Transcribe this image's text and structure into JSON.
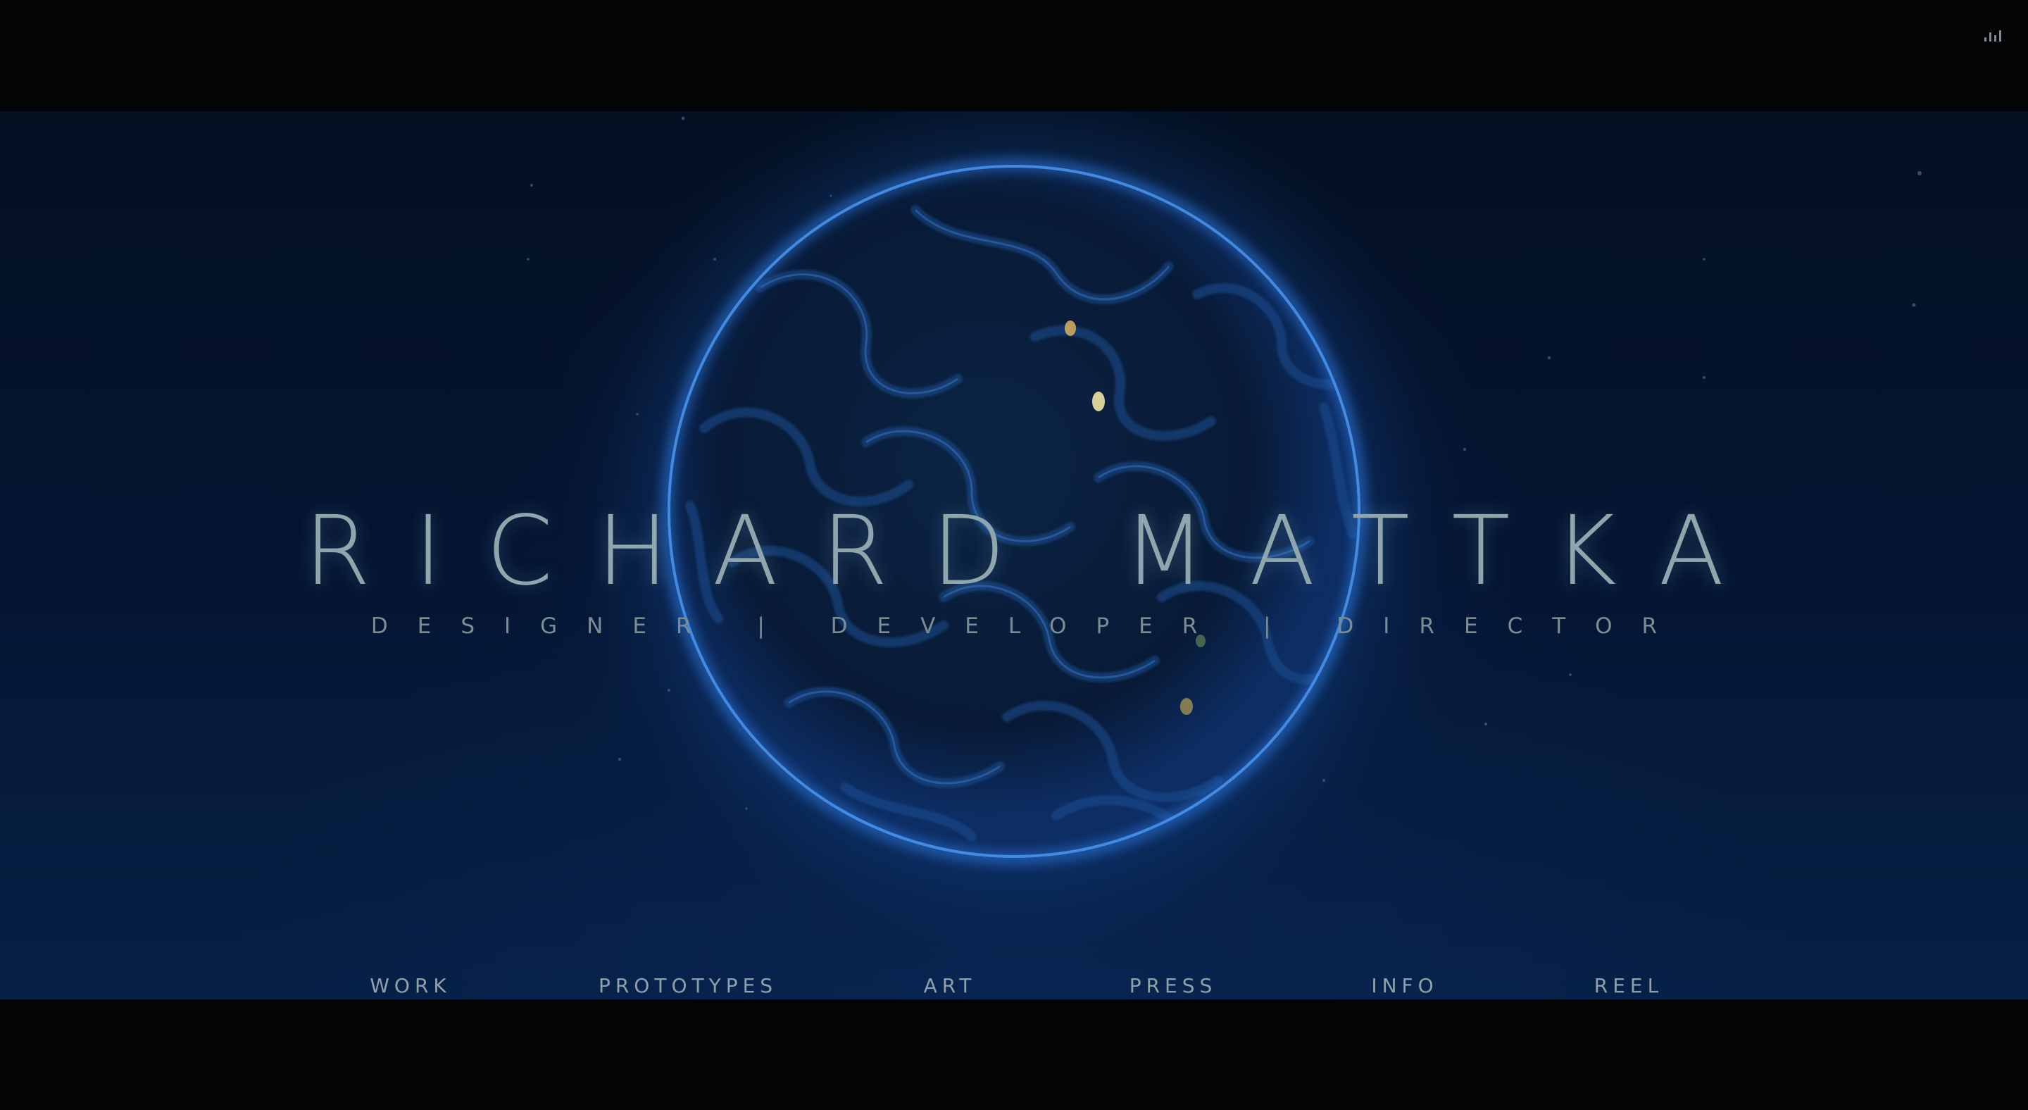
{
  "header": {
    "audio_icon": "audio-bars-icon"
  },
  "hero": {
    "title": "RICHARD MATTKA",
    "subtitle": "DESIGNER | DEVELOPER | DIRECTOR",
    "visual": "glowing-sphere"
  },
  "nav": {
    "items": [
      {
        "label": "WORK"
      },
      {
        "label": "PROTOTYPES"
      },
      {
        "label": "ART"
      },
      {
        "label": "PRESS"
      },
      {
        "label": "INFO"
      },
      {
        "label": "REEL"
      }
    ]
  },
  "colors": {
    "background": "#030406",
    "stage": "#051430",
    "glow": "#2a6fd0",
    "text": "#8fa6ad"
  }
}
